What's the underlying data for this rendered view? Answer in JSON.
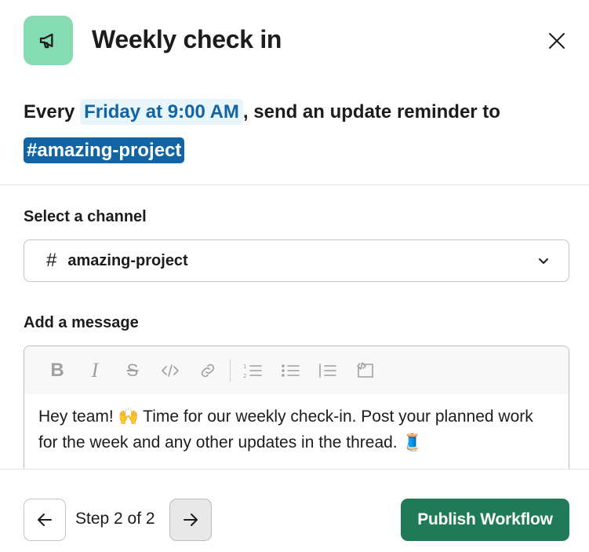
{
  "header": {
    "title": "Weekly check in",
    "icon": "megaphone-icon",
    "icon_bg": "#86dcb2"
  },
  "schedule": {
    "prefix": "Every",
    "time": "Friday at 9:00 AM",
    "middle": ", send an update reminder to",
    "channel": "#amazing-project"
  },
  "channel_field": {
    "label": "Select a channel",
    "value": "amazing-project"
  },
  "message_field": {
    "label": "Add a message",
    "toolbar": [
      "bold-icon",
      "italic-icon",
      "strikethrough-icon",
      "code-icon",
      "link-icon",
      "numbered-list-icon",
      "bulleted-list-icon",
      "indent-icon",
      "code-block-icon"
    ],
    "text_part1": "Hey team! ",
    "emoji1": "🙌",
    "text_part2": " Time for our weekly check-in. Post your planned work for the week and any other updates in the thread. ",
    "emoji2": "🧵"
  },
  "footer": {
    "step_text": "Step 2 of 2",
    "publish_label": "Publish Workflow",
    "accent": "#1f7a57"
  }
}
